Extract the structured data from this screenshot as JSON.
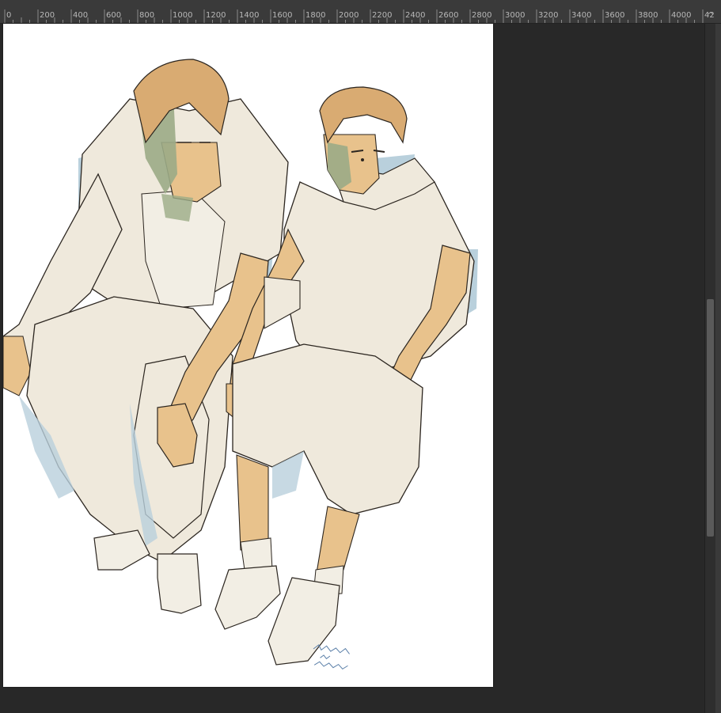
{
  "ruler": {
    "labels": [
      "0",
      "200",
      "400",
      "600",
      "800",
      "1000",
      "1200",
      "1400",
      "1600",
      "1800",
      "2000",
      "2200",
      "2400",
      "2600",
      "2800",
      "3000",
      "3200",
      "3400",
      "3600",
      "3800",
      "4000",
      "42"
    ],
    "scroll_up_icon": "chevron-up-icon"
  },
  "canvas": {
    "artwork": "sketch of two young men sitting side by side",
    "signature_text": "DRAWING IN PROGRESS",
    "palette": {
      "skin": "#e8c28c",
      "clothes": "#efe9dc",
      "shadow_blue": "#b9d0dc",
      "shadow_green": "#9bab86",
      "hair": "#d9ab72",
      "line": "#2c2620"
    }
  },
  "colors": {
    "workspace": "#282828",
    "ruler_bg": "#3a3a3a",
    "ruler_text": "#b8b8b8",
    "scroll_thumb": "#5a5a5a"
  }
}
